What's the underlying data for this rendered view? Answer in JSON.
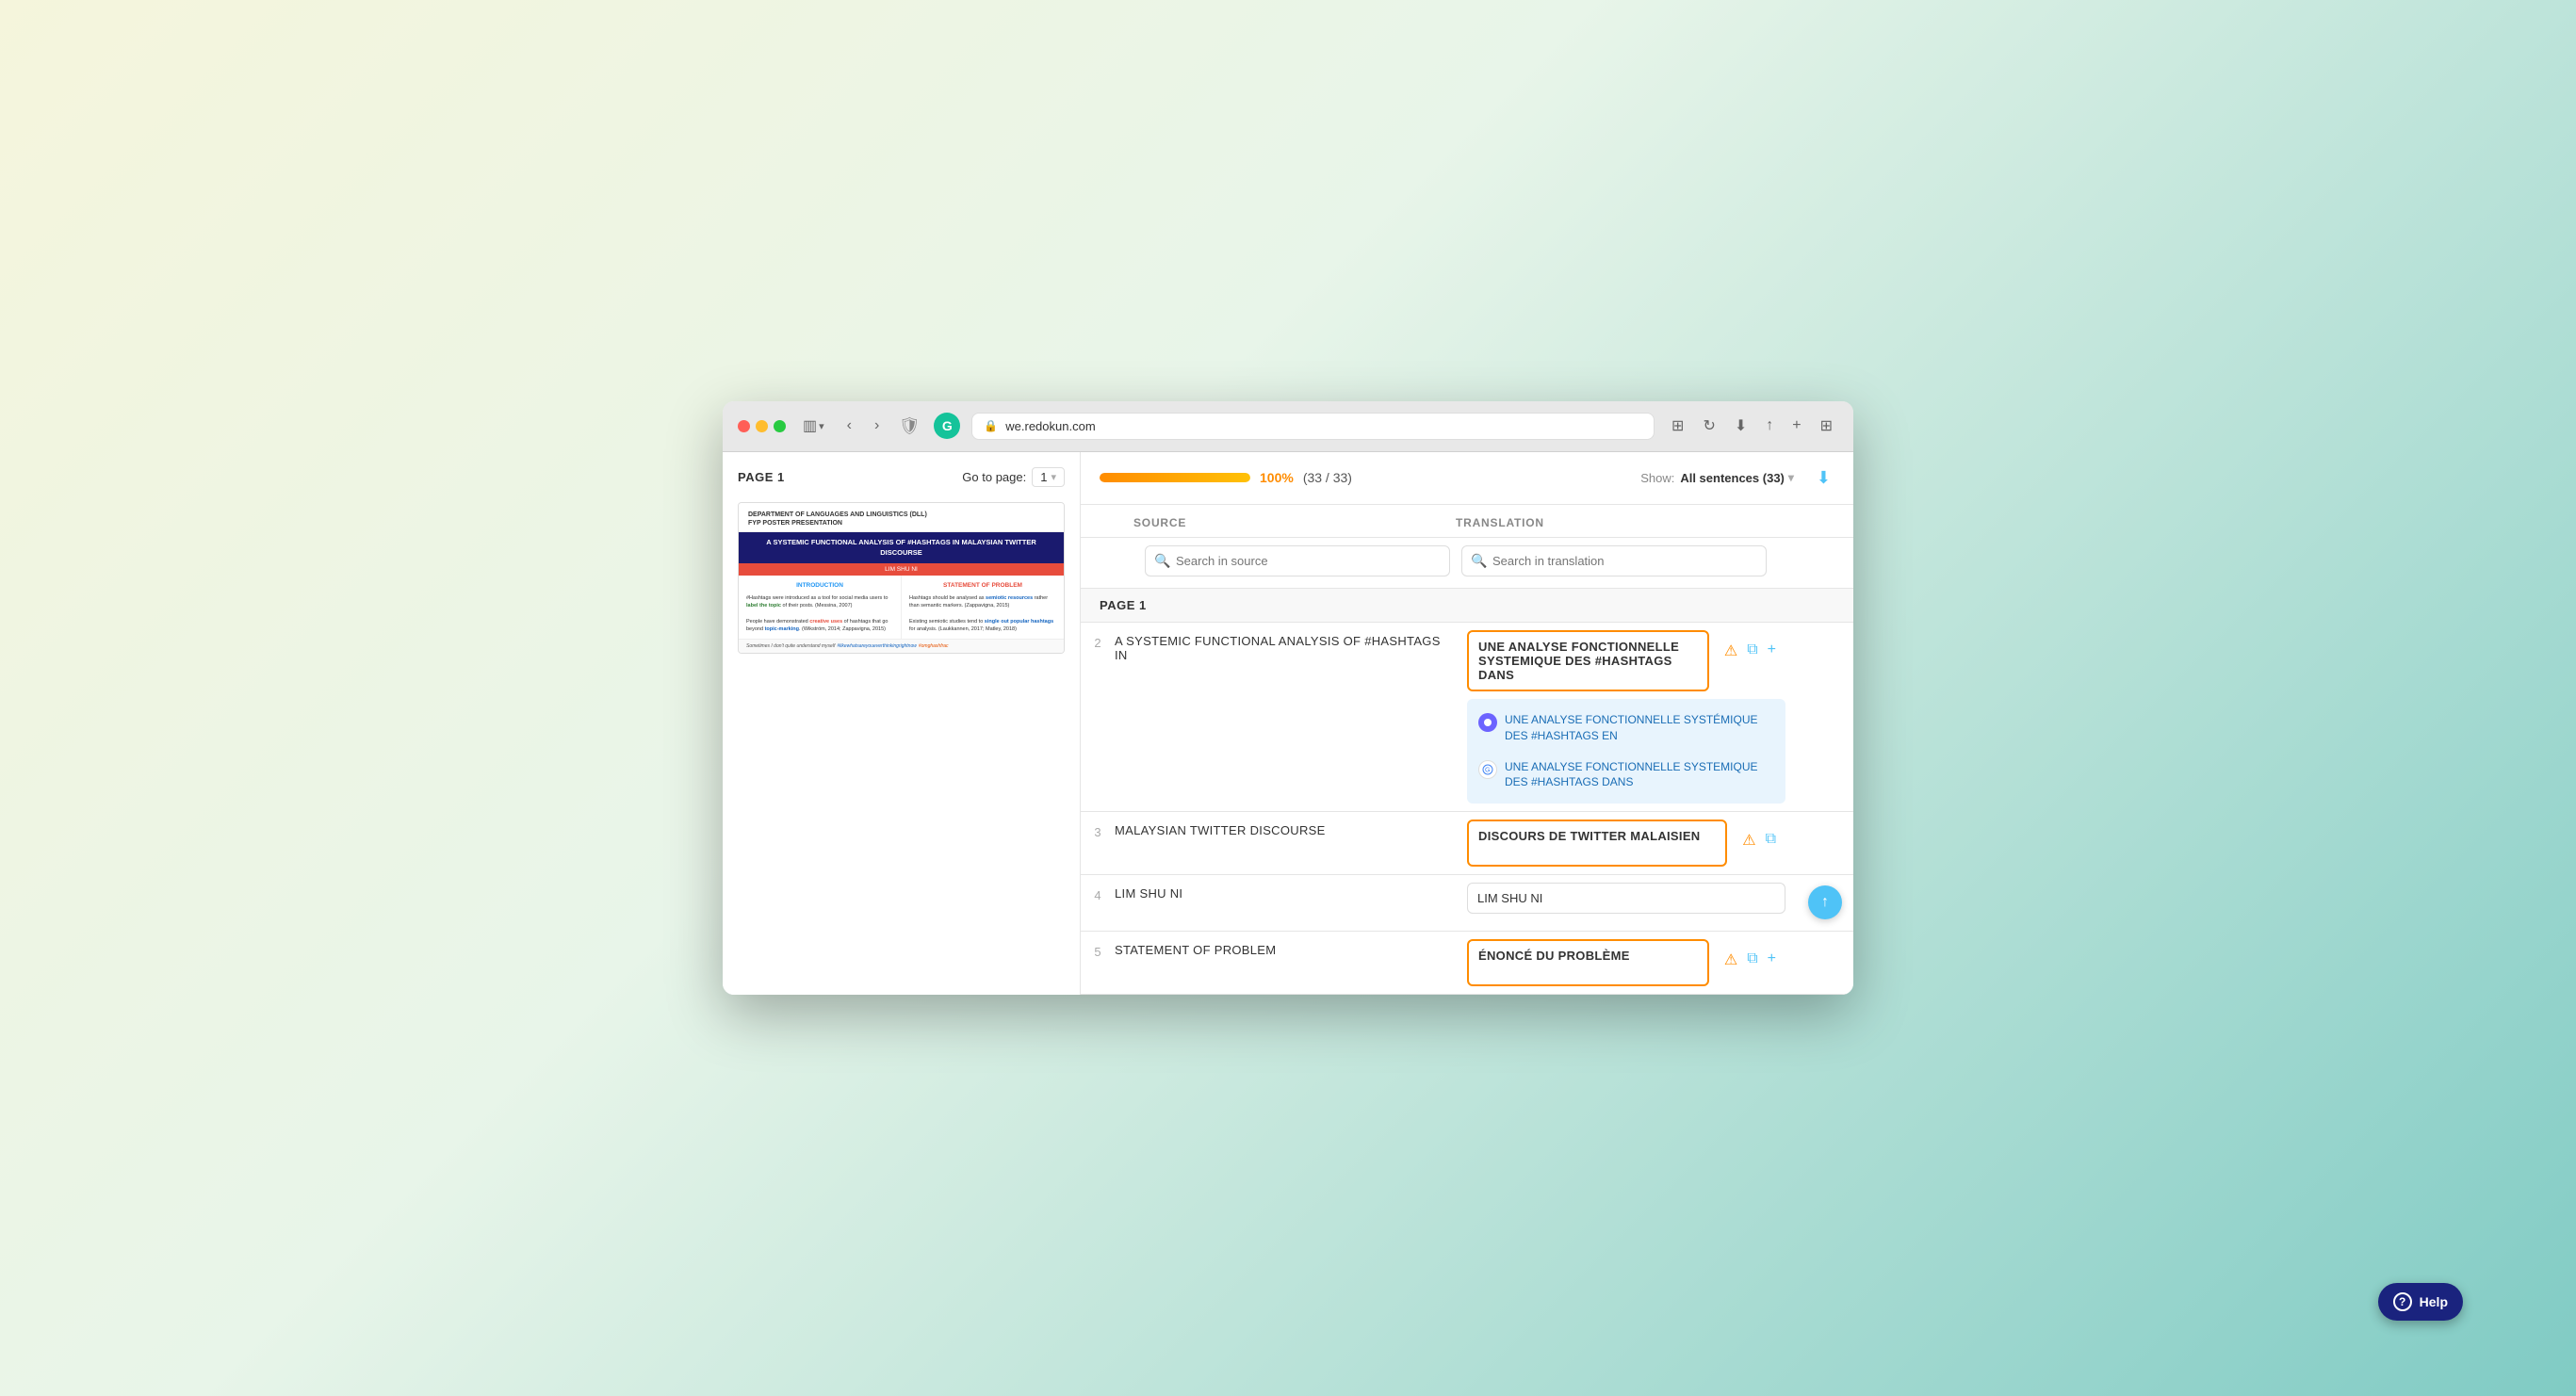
{
  "browser": {
    "url": "we.redokun.com",
    "grammarly_label": "G",
    "shield_label": "🛡"
  },
  "header": {
    "page_label": "PAGE 1",
    "goto_label": "Go to page:",
    "page_num": "1",
    "progress_percent": "100%",
    "progress_count": "(33 / 33)",
    "show_label": "Show:",
    "filter_value": "All sentences (33)",
    "progress_bar_width": "100"
  },
  "columns": {
    "source_label": "SOURCE",
    "translation_label": "TRANSLATION"
  },
  "search": {
    "source_placeholder": "Search in source",
    "translation_placeholder": "Search in translation"
  },
  "page_section": "PAGE 1",
  "rows": [
    {
      "num": "2",
      "source": "A SYSTEMIC FUNCTIONAL ANALYSIS OF #HASHTAGS IN",
      "translation": "UNE ANALYSE FONCTIONNELLE SYSTEMIQUE DES #HASHTAGS DANS",
      "has_suggestions": true,
      "suggestions": [
        {
          "icon_type": "ai",
          "text": "UNE ANALYSE FONCTIONNELLE SYSTÉMIQUE DES #HASHTAGS EN"
        },
        {
          "icon_type": "google",
          "text": "UNE ANALYSE FONCTIONNELLE SYSTEMIQUE DES #HASHTAGS DANS"
        }
      ],
      "active": true
    },
    {
      "num": "3",
      "source": "MALAYSIAN TWITTER DISCOURSE",
      "translation": "DISCOURS DE TWITTER MALAISIEN",
      "has_suggestions": false,
      "active": false
    },
    {
      "num": "4",
      "source": "LIM SHU NI",
      "translation": "LIM SHU NI",
      "has_suggestions": false,
      "active": false
    },
    {
      "num": "5",
      "source": "STATEMENT OF PROBLEM",
      "translation": "ÉNONCÉ DU PROBLÈME",
      "has_suggestions": false,
      "active": false
    }
  ],
  "document_preview": {
    "dept_line": "DEPARTMENT OF LANGUAGES AND LINGUISTICS (DLL)",
    "fyp_line": "FYP POSTER PRESENTATION",
    "main_title": "A SYSTEMIC FUNCTIONAL ANALYSIS OF #HASHTAGS IN MALAYSIAN TWITTER DISCOURSE",
    "author": "LIM SHU NI",
    "intro_title": "INTRODUCTION",
    "problem_title": "STATEMENT OF PROBLEM",
    "intro_text1": "#Hashtags were introduced as a tool for social media users to label the topic of their posts. (Messina, 2007)",
    "intro_text2": "People have demonstrated creative uses of hashtags that go beyond topic-marking. (Wikström, 2014; Zappavigna, 2015)",
    "problem_text1": "Hashtags should be analysed as semiotic resources rather than semantic markers. (Zappavigna, 2015)",
    "problem_text2": "Existing semiotic studies tend to single out popular hashtags for analysis. (Laukkannen, 2017; Matley, 2018)",
    "footer_text": "Sometimes I don't quite understand myself #likewhatsareyoueverthinkingrightnow #omghashfrac"
  },
  "help": {
    "label": "Help"
  }
}
